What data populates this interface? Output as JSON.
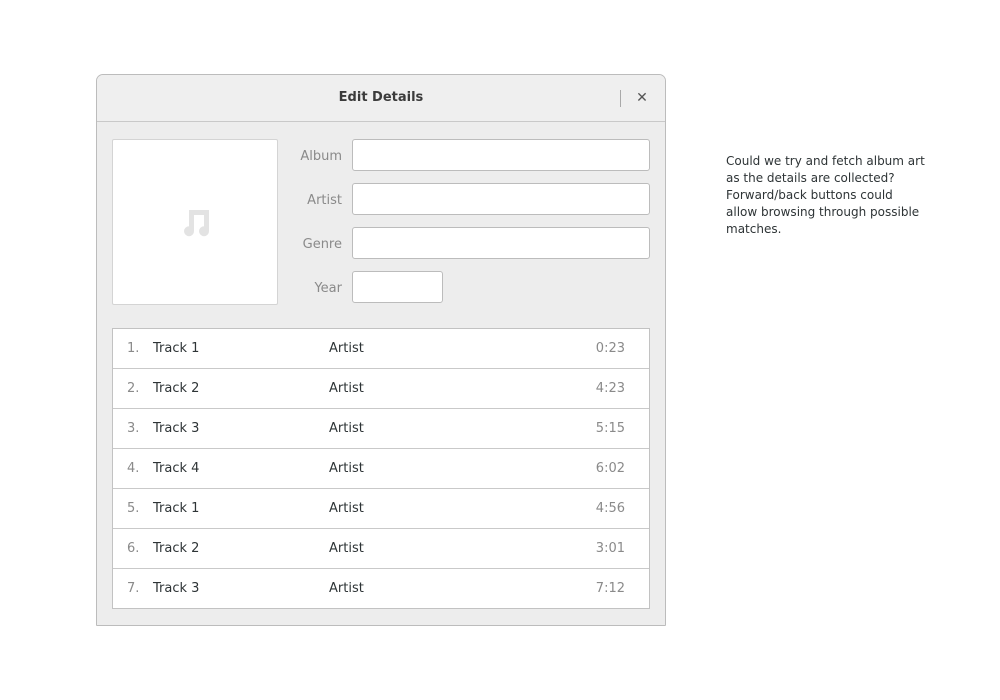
{
  "dialog": {
    "title": "Edit Details",
    "close_icon": "close-icon"
  },
  "art": {
    "icon": "music-note-icon"
  },
  "form": {
    "album_label": "Album",
    "album_value": "",
    "artist_label": "Artist",
    "artist_value": "",
    "genre_label": "Genre",
    "genre_value": "",
    "year_label": "Year",
    "year_value": ""
  },
  "tracks": [
    {
      "num": "1.",
      "title": "Track 1",
      "artist": "Artist",
      "duration": "0:23"
    },
    {
      "num": "2.",
      "title": "Track 2",
      "artist": "Artist",
      "duration": "4:23"
    },
    {
      "num": "3.",
      "title": "Track 3",
      "artist": "Artist",
      "duration": "5:15"
    },
    {
      "num": "4.",
      "title": "Track 4",
      "artist": "Artist",
      "duration": "6:02"
    },
    {
      "num": "5.",
      "title": "Track 1",
      "artist": "Artist",
      "duration": "4:56"
    },
    {
      "num": "6.",
      "title": "Track 2",
      "artist": "Artist",
      "duration": "3:01"
    },
    {
      "num": "7.",
      "title": "Track 3",
      "artist": "Artist",
      "duration": "7:12"
    }
  ],
  "note": {
    "lines": [
      "Could we try and fetch album art",
      "as the details are collected?",
      "Forward/back buttons could",
      "allow browsing through possible",
      "matches."
    ]
  }
}
